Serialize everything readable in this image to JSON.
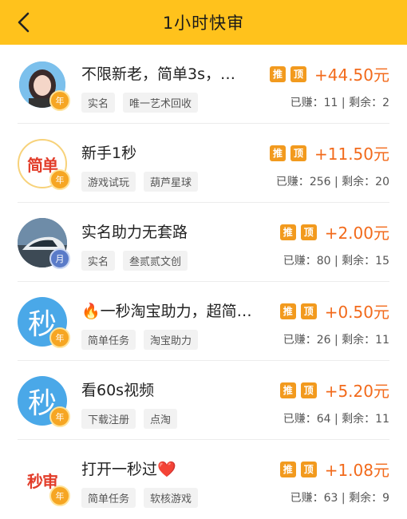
{
  "header": {
    "title": "1小时快审",
    "back_icon": "chevron-left-icon"
  },
  "items": [
    {
      "title": "不限新老，简单3s，…",
      "tags": [
        "实名",
        "唯一艺术回收"
      ],
      "flags": [
        "推",
        "顶"
      ],
      "reward": "+44.50元",
      "earned_label": "已赚：",
      "earned": "11",
      "remain_label": "剩余：",
      "remain": "2",
      "avatar_text": "",
      "badge": "年"
    },
    {
      "title": "新手1秒",
      "tags": [
        "游戏试玩",
        "葫芦星球"
      ],
      "flags": [
        "推",
        "顶"
      ],
      "reward": "+11.50元",
      "earned_label": "已赚：",
      "earned": "256",
      "remain_label": "剩余：",
      "remain": "20",
      "avatar_text": "简单",
      "badge": "年"
    },
    {
      "title": "实名助力无套路",
      "tags": [
        "实名",
        "叁贰贰文创"
      ],
      "flags": [
        "推",
        "顶"
      ],
      "reward": "+2.00元",
      "earned_label": "已赚：",
      "earned": "80",
      "remain_label": "剩余：",
      "remain": "15",
      "avatar_text": "",
      "badge": "月"
    },
    {
      "title": "🔥一秒淘宝助力，超简…",
      "tags": [
        "简单任务",
        "淘宝助力"
      ],
      "flags": [
        "推",
        "顶"
      ],
      "reward": "+0.50元",
      "earned_label": "已赚：",
      "earned": "26",
      "remain_label": "剩余：",
      "remain": "11",
      "avatar_text": "秒",
      "badge": "年"
    },
    {
      "title": "看60s视频",
      "tags": [
        "下载注册",
        "点淘"
      ],
      "flags": [
        "推",
        "顶"
      ],
      "reward": "+5.20元",
      "earned_label": "已赚：",
      "earned": "64",
      "remain_label": "剩余：",
      "remain": "11",
      "avatar_text": "秒",
      "badge": "年"
    },
    {
      "title": "打开一秒过❤️",
      "tags": [
        "简单任务",
        "软核游戏"
      ],
      "flags": [
        "推",
        "顶"
      ],
      "reward": "+1.08元",
      "earned_label": "已赚：",
      "earned": "63",
      "remain_label": "剩余：",
      "remain": "9",
      "avatar_text": "秒审",
      "badge": "年"
    }
  ]
}
